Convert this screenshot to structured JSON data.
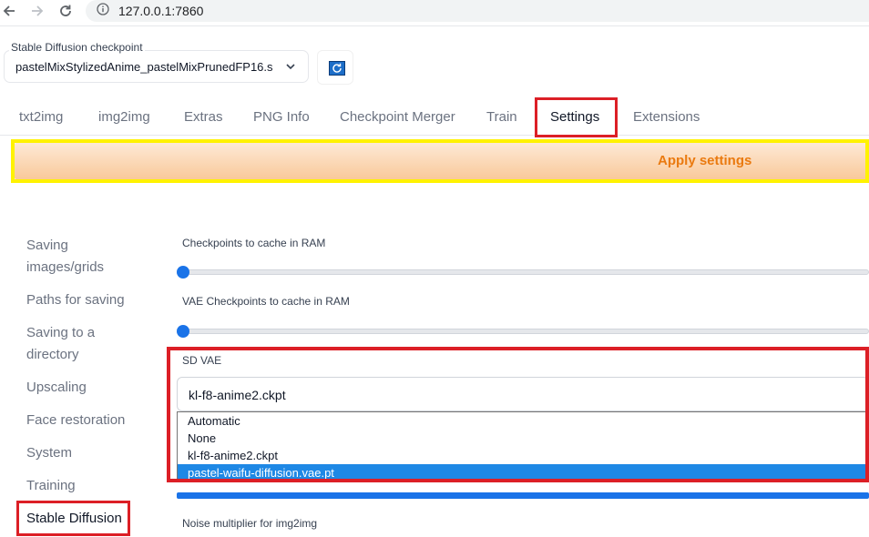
{
  "browser": {
    "url": "127.0.0.1:7860"
  },
  "checkpoint": {
    "label": "Stable Diffusion checkpoint",
    "value": "pastelMixStylizedAnime_pastelMixPrunedFP16.s"
  },
  "tabs": [
    {
      "label": "txt2img"
    },
    {
      "label": "img2img"
    },
    {
      "label": "Extras"
    },
    {
      "label": "PNG Info"
    },
    {
      "label": "Checkpoint Merger"
    },
    {
      "label": "Train"
    },
    {
      "label": "Settings"
    },
    {
      "label": "Extensions"
    }
  ],
  "apply_label": "Apply settings",
  "sidebar": {
    "items": [
      {
        "label": "Saving"
      },
      {
        "label": "images/grids"
      },
      {
        "label": "Paths for saving"
      },
      {
        "label": "Saving to a"
      },
      {
        "label": "directory"
      },
      {
        "label": "Upscaling"
      },
      {
        "label": "Face restoration"
      },
      {
        "label": "System"
      },
      {
        "label": "Training"
      },
      {
        "label": "Stable Diffusion"
      }
    ]
  },
  "settings": {
    "checkpoints_cache_label": "Checkpoints to cache in RAM",
    "checkpoints_cache_value": 0,
    "vae_cache_label": "VAE Checkpoints to cache in RAM",
    "vae_cache_value": 0,
    "sd_vae_label": "SD VAE",
    "sd_vae_value": "kl-f8-anime2.ckpt",
    "sd_vae_options": [
      {
        "label": "Automatic"
      },
      {
        "label": "None"
      },
      {
        "label": "kl-f8-anime2.ckpt"
      },
      {
        "label": "pastel-waifu-diffusion.vae.pt"
      }
    ],
    "sd_vae_highlighted": "pastel-waifu-diffusion.vae.pt",
    "noise_label": "Noise multiplier for img2img"
  },
  "colors": {
    "highlight_red": "#dc1f26",
    "highlight_yellow": "#fff200",
    "accent_blue": "#1a73e8",
    "apply_text": "#ea7a10"
  },
  "icons": {
    "back": "arrow-left-icon",
    "forward": "arrow-right-icon",
    "reload": "reload-icon",
    "site_info": "info-icon",
    "dropdown": "chevron-down-icon",
    "refresh": "refresh-icon"
  }
}
